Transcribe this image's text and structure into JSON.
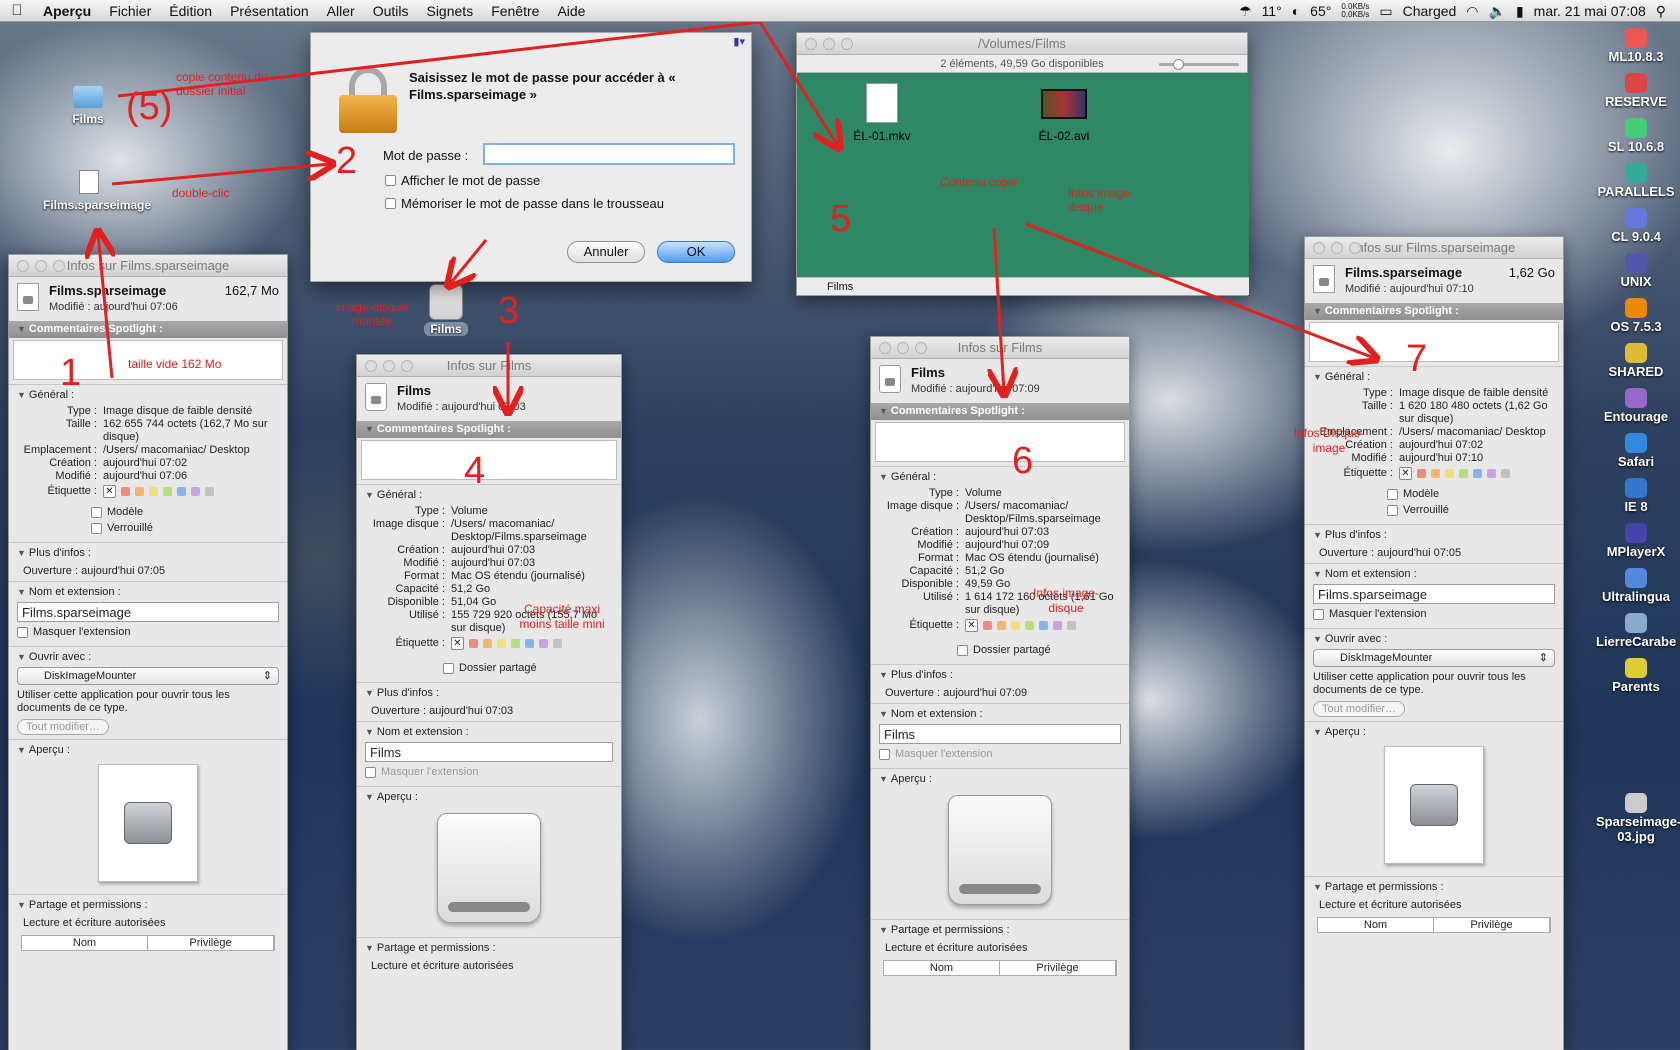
{
  "menubar": {
    "app": "Aperçu",
    "items": [
      "Fichier",
      "Édition",
      "Présentation",
      "Aller",
      "Outils",
      "Signets",
      "Fenêtre",
      "Aide"
    ],
    "temp1": "11°",
    "temp2": "65°",
    "net_up": "0.0KB/s",
    "net_down": "0.0KB/s",
    "battery": "Charged",
    "datetime": "mar. 21 mai  07:08"
  },
  "dialog": {
    "title": "Saisissez le mot de passe pour accéder à « Films.sparseimage »",
    "password_label": "Mot de passe :",
    "password_value": "",
    "show_password": "Afficher le mot de passe",
    "remember": "Mémoriser le mot de passe dans le trousseau",
    "cancel": "Annuler",
    "ok": "OK"
  },
  "finder": {
    "title": "/Volumes/Films",
    "status": "2 éléments, 49,59 Go disponibles",
    "files": [
      {
        "name": "ÉL-01.mkv"
      },
      {
        "name": "ÉL-02.avi"
      }
    ],
    "path": "Films"
  },
  "desktop": {
    "icons": [
      {
        "label": "Films"
      },
      {
        "label": "Films.sparseimage"
      },
      {
        "label": "Films"
      }
    ],
    "dock": [
      "ML10.8.3",
      "RESERVE",
      "SL 10.6.8",
      "PARALLELS",
      "CL 9.0.4",
      "UNIX",
      "OS 7.5.3",
      "SHARED",
      "Entourage",
      "Safari",
      "IE 8",
      "MPlayerX",
      "Ultralingua",
      "LierreCarabe",
      "Parents",
      "Sparseimage-03.jpg"
    ]
  },
  "annotations": {
    "n1": "1",
    "n2": "2",
    "n3": "3",
    "n4": "4",
    "n5": "5",
    "n5b": "(5)",
    "n6": "6",
    "n7": "7",
    "copie": "copie contenu du dossier initial",
    "double": "double-clic",
    "taille": "taille vide 162 Mo",
    "imgmontee": "image-disque montée",
    "contenu": "Contenu copié",
    "infos5": "Infos image-disque",
    "capacite": "Capacité maxi moins taille mini",
    "infos6": "Infos image-disque",
    "infos7": "Infos Disque-image"
  },
  "win1": {
    "title": "Infos sur Films.sparseimage",
    "name": "Films.sparseimage",
    "size": "162,7 Mo",
    "modified": "Modifié : aujourd'hui 07:06",
    "spotlight": "Commentaires Spotlight :",
    "general": "Général :",
    "rows": [
      [
        "Type :",
        "Image disque de faible densité"
      ],
      [
        "Taille :",
        "162 655 744 octets (162,7 Mo sur disque)"
      ],
      [
        "Emplacement :",
        "/Users/ macomaniac/ Desktop"
      ],
      [
        "Création :",
        "aujourd'hui 07:02"
      ],
      [
        "Modifié :",
        "aujourd'hui 07:06"
      ]
    ],
    "label": "Étiquette :",
    "modele": "Modèle",
    "verrouille": "Verrouillé",
    "plus": "Plus d'infos :",
    "ouverture": "Ouverture : aujourd'hui 07:05",
    "nom": "Nom et extension :",
    "nomval": "Films.sparseimage",
    "masquer": "Masquer l'extension",
    "ouvrir": "Ouvrir avec :",
    "app": "DiskImageMounter",
    "appdesc": "Utiliser cette application pour ouvrir tous les documents de ce type.",
    "tout": "Tout modifier…",
    "apercu": "Aperçu :",
    "partage": "Partage et permissions :",
    "lecture": "Lecture et écriture autorisées",
    "col1": "Nom",
    "col2": "Privilège"
  },
  "win2": {
    "title": "Infos sur Films",
    "name": "Films",
    "modified": "Modifié : aujourd'hui 07:03",
    "spotlight": "Commentaires Spotlight :",
    "general": "Général :",
    "rows": [
      [
        "Type :",
        "Volume"
      ],
      [
        "Image disque :",
        "/Users/ macomaniac/ Desktop/Films.sparseimage"
      ],
      [
        "Création :",
        "aujourd'hui 07:03"
      ],
      [
        "Modifié :",
        "aujourd'hui 07:03"
      ],
      [
        "Format :",
        "Mac OS étendu (journalisé)"
      ],
      [
        "Capacité :",
        "51,2 Go"
      ],
      [
        "Disponible :",
        "51,04 Go"
      ],
      [
        "Utilisé :",
        "155 729 920 octets (155,7 Mo sur disque)"
      ]
    ],
    "label": "Étiquette :",
    "partagedos": "Dossier partagé",
    "plus": "Plus d'infos :",
    "ouverture": "Ouverture : aujourd'hui 07:03",
    "nom": "Nom et extension :",
    "nomval": "Films",
    "masquer": "Masquer l'extension",
    "apercu": "Aperçu :",
    "partage": "Partage et permissions :",
    "lecture": "Lecture et écriture autorisées"
  },
  "win3": {
    "title": "Infos sur Films",
    "name": "Films",
    "modified": "Modifié : aujourd'hui 07:09",
    "spotlight": "Commentaires Spotlight :",
    "general": "Général :",
    "rows": [
      [
        "Type :",
        "Volume"
      ],
      [
        "Image disque :",
        "/Users/ macomaniac/ Desktop/Films.sparseimage"
      ],
      [
        "Création :",
        "aujourd'hui 07:03"
      ],
      [
        "Modifié :",
        "aujourd'hui 07:09"
      ],
      [
        "Format :",
        "Mac OS étendu (journalisé)"
      ],
      [
        "Capacité :",
        "51,2 Go"
      ],
      [
        "Disponible :",
        "49,59 Go"
      ],
      [
        "Utilisé :",
        "1 614 172 160 octets (1,61 Go sur disque)"
      ]
    ],
    "label": "Étiquette :",
    "partagedos": "Dossier partagé",
    "plus": "Plus d'infos :",
    "ouverture": "Ouverture : aujourd'hui 07:09",
    "nom": "Nom et extension :",
    "nomval": "Films",
    "masquer": "Masquer l'extension",
    "apercu": "Aperçu :",
    "partage": "Partage et permissions :",
    "lecture": "Lecture et écriture autorisées",
    "col1": "Nom",
    "col2": "Privilège"
  },
  "win4": {
    "title": "Infos sur Films.sparseimage",
    "name": "Films.sparseimage",
    "size": "1,62 Go",
    "modified": "Modifié : aujourd'hui 07:10",
    "spotlight": "Commentaires Spotlight :",
    "general": "Général :",
    "rows": [
      [
        "Type :",
        "Image disque de faible densité"
      ],
      [
        "Taille :",
        "1 620 180 480 octets (1,62 Go sur disque)"
      ],
      [
        "Emplacement :",
        "/Users/ macomaniac/ Desktop"
      ],
      [
        "Création :",
        "aujourd'hui 07:02"
      ],
      [
        "Modifié :",
        "aujourd'hui 07:10"
      ]
    ],
    "label": "Étiquette :",
    "modele": "Modèle",
    "verrouille": "Verrouillé",
    "plus": "Plus d'infos :",
    "ouverture": "Ouverture : aujourd'hui 07:05",
    "nom": "Nom et extension :",
    "nomval": "Films.sparseimage",
    "masquer": "Masquer l'extension",
    "ouvrir": "Ouvrir avec :",
    "app": "DiskImageMounter",
    "appdesc": "Utiliser cette application pour ouvrir tous les documents de ce type.",
    "tout": "Tout modifier…",
    "apercu": "Aperçu :",
    "partage": "Partage et permissions :",
    "lecture": "Lecture et écriture autorisées",
    "col1": "Nom",
    "col2": "Privilège"
  },
  "colors": {
    "annotation": "#e32020",
    "finder_bg": "#2e8765"
  }
}
